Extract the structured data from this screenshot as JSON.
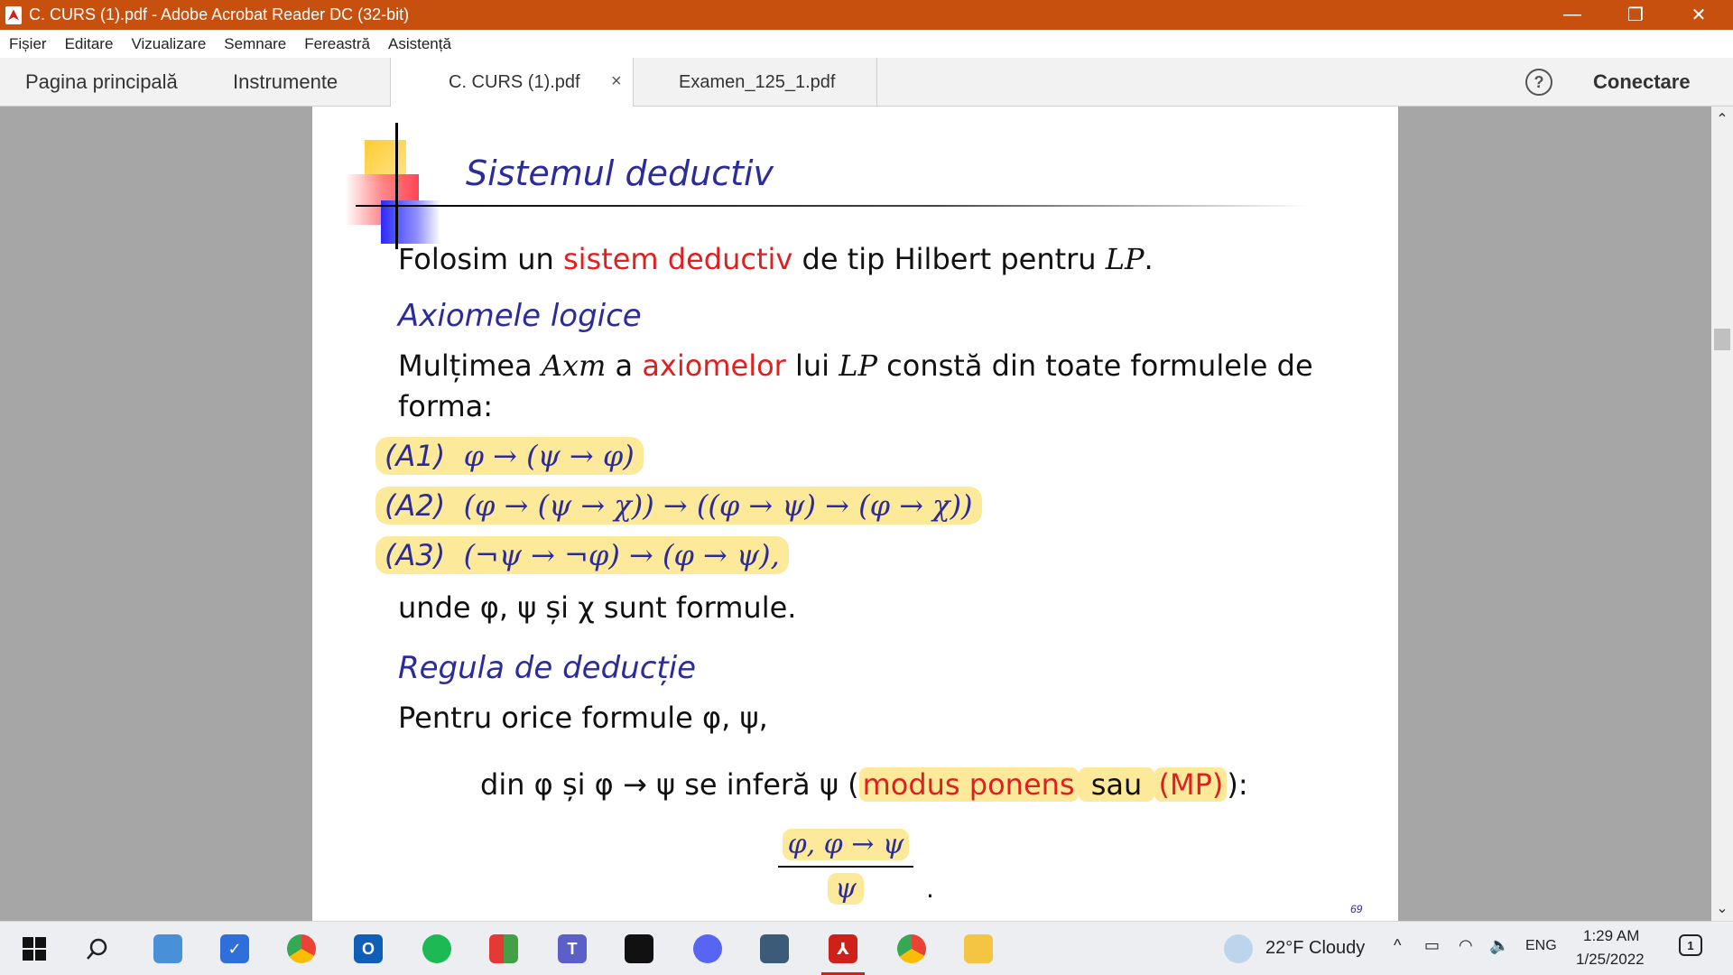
{
  "window": {
    "title": "C. CURS (1).pdf - Adobe Acrobat Reader DC (32-bit)",
    "minimize": "—",
    "restore": "❐",
    "close": "✕"
  },
  "menu": [
    "Fișier",
    "Editare",
    "Vizualizare",
    "Semnare",
    "Fereastră",
    "Asistență"
  ],
  "tabs": {
    "home": "Pagina principală",
    "tools": "Instrumente",
    "docs": [
      {
        "label": "C. CURS (1).pdf",
        "active": true,
        "close": "×"
      },
      {
        "label": "Examen_125_1.pdf",
        "active": false
      }
    ],
    "help": "?",
    "login": "Conectare"
  },
  "slide": {
    "title": "Sistemul deductiv",
    "intro_pre": "Folosim un ",
    "intro_red": "sistem deductiv",
    "intro_post": " de tip Hilbert pentru ",
    "intro_lp": "LP",
    "intro_end": ".",
    "heading_axioms": "Axiomele logice",
    "axm_pre": "Mulțimea ",
    "axm_sym": "Axm",
    "axm_mid": " a ",
    "axm_red": "axiomelor",
    "axm_post": " lui ",
    "axm_lp": "LP",
    "axm_end": " constă din toate formulele de",
    "axm_line2": "forma:",
    "axioms": [
      {
        "label": "(A1)",
        "formula": "φ → (ψ → φ)"
      },
      {
        "label": "(A2)",
        "formula": "(φ → (ψ → χ)) → ((φ → ψ) → (φ → χ))"
      },
      {
        "label": "(A3)",
        "formula": "(¬ψ → ¬φ) → (φ → ψ),"
      }
    ],
    "where": "unde φ, ψ și χ sunt formule.",
    "heading_rule": "Regula de deducție",
    "rule_line": "Pentru orice formule φ, ψ,",
    "mp_pre": "din φ și φ → ψ se inferă ψ (",
    "mp_red1": "modus ponens",
    "mp_mid": " sau ",
    "mp_red2": "(MP)",
    "mp_end": "):",
    "frac_num": "φ,  φ → ψ",
    "frac_den": "ψ",
    "frac_dot": ".",
    "page_number": "69"
  },
  "taskbar": {
    "weather": "22°F  Cloudy",
    "lang": "ENG",
    "time": "1:29 AM",
    "date": "1/25/2022",
    "notifications": "1"
  }
}
